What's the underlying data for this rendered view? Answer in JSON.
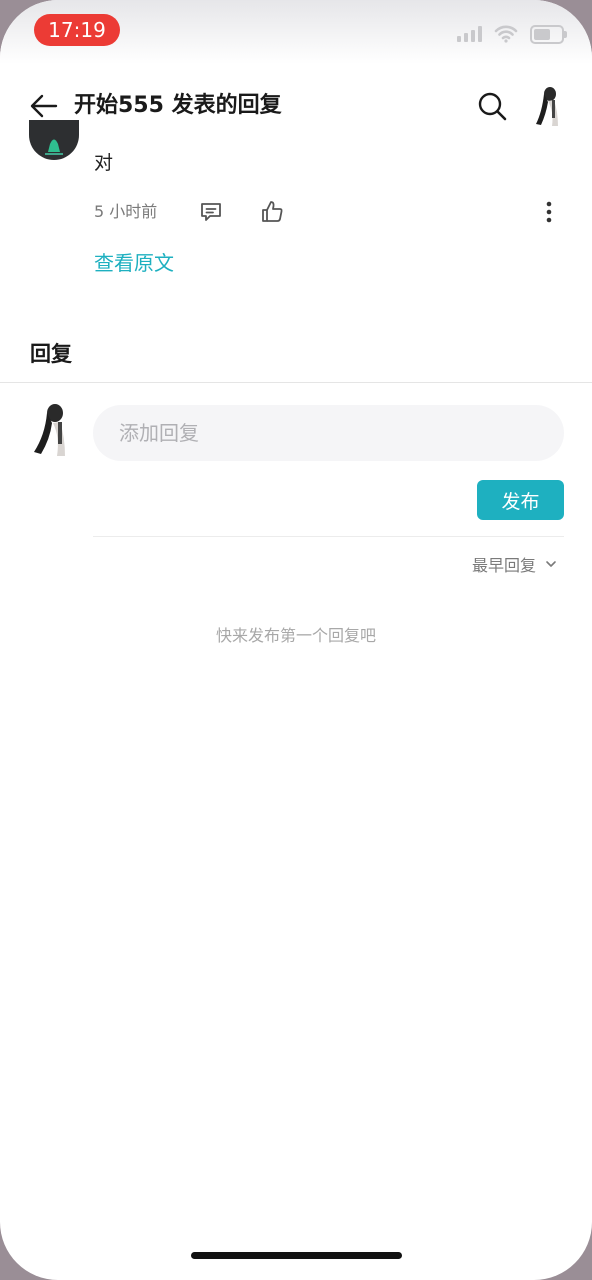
{
  "status_bar": {
    "time": "17:19"
  },
  "nav": {
    "title": "开始555 发表的回复"
  },
  "original_comment": {
    "text": "对",
    "time": "5 小时前",
    "view_original_label": "查看原文"
  },
  "replies": {
    "heading": "回复",
    "input_placeholder": "添加回复",
    "publish_label": "发布",
    "sort_label": "最早回复",
    "empty_hint": "快来发布第一个回复吧"
  },
  "colors": {
    "accent": "#1eb0c0",
    "time_pill": "#ec3b35"
  }
}
